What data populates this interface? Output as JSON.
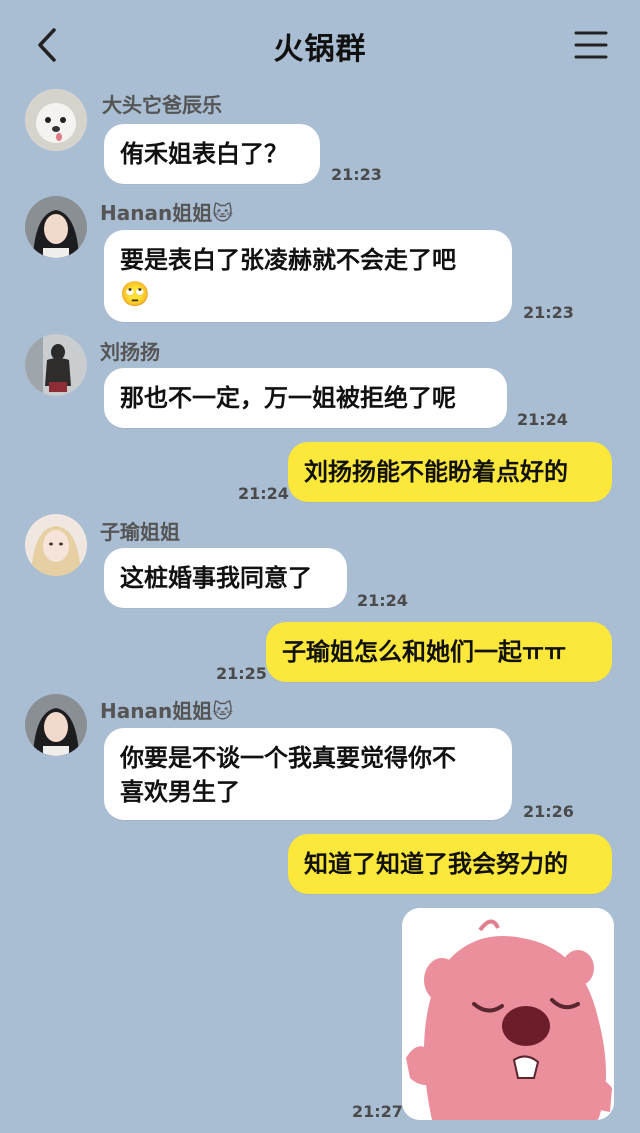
{
  "header": {
    "title": "火锅群"
  },
  "messages": [
    {
      "sender": "大头它爸辰乐",
      "text": "侑禾姐表白了？",
      "time": "21:23"
    },
    {
      "sender": "Hanan姐姐🐱",
      "text": "要是表白了张凌赫就不会走了吧",
      "emoji": "🙄",
      "time": "21:23"
    },
    {
      "sender": "刘扬扬",
      "text": "那也不一定，万一姐被拒绝了呢",
      "time": "21:24"
    },
    {
      "mine": true,
      "text": "刘扬扬能不能盼着点好的",
      "time": "21:24"
    },
    {
      "sender": "子瑜姐姐",
      "text": "这桩婚事我同意了",
      "time": "21:24"
    },
    {
      "mine": true,
      "text": "子瑜姐怎么和她们一起ㅠㅠ",
      "time": "21:25"
    },
    {
      "sender": "Hanan姐姐🐱",
      "text_line1": "你要是不谈一个我真要觉得你不",
      "text_line2": "喜欢男生了",
      "time": "21:26"
    },
    {
      "mine": true,
      "text": "知道了知道了我会努力的",
      "time": ""
    },
    {
      "mine": true,
      "sticker": "pink-beaver-sticker",
      "time": "21:27"
    }
  ]
}
